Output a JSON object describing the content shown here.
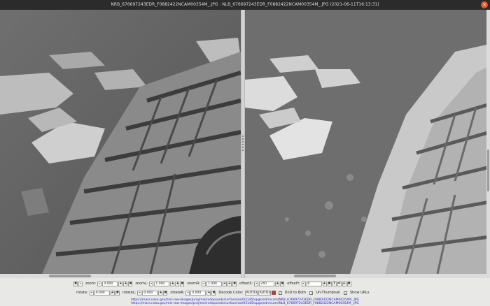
{
  "window": {
    "title": "NRB_676697243EDR_F0882422NCAM00354M_.JPG : NLB_676697243EDR_F0882422NCAM00354M_.JPG (2021-06-11T16:13:31)",
    "close_icon": "close-icon"
  },
  "images": {
    "left": {
      "alt": "NRB_676697243EDR_F0882422NCAM00354M_.JPG"
    },
    "right": {
      "alt": "NLB_676697243EDR_F0882422NCAM00354M_.JPG"
    }
  },
  "controls": {
    "zoom_label": "zoom:",
    "zoom_value": "4.000",
    "zoomL_label": "zoomL:",
    "zoomL_value": "1.000",
    "zoomR_label": "zoomR:",
    "zoomR_value": "1.000",
    "offsetX_label": "offsetX:",
    "offsetX_value": "240",
    "offsetY_label": "offsetY:",
    "offsetY_value": "0",
    "rotate_label": "rotate:",
    "rotate_value": "0.000",
    "rotateL_label": "rotateL:",
    "rotateL_value": "0.000",
    "rotateR_label": "rotateR:",
    "rotateR_value": "0.000",
    "decode_label": "Decode Color:",
    "decode_left": "AUTO3",
    "decode_right": "AUTO3",
    "dnd_label": "DnD to Both",
    "unthumb_label": "Un-Thumbnail",
    "showurls_label": "Show URLs",
    "btn_minus": "-",
    "btn_plus": "+",
    "btn_x": "✖",
    "btn_q": "?",
    "btn_eq": "="
  },
  "urls": {
    "right": "https://mars.nasa.gov/msl-raw-images/proj/msl/redops/ods/surface/sol/03145/opgs/edr/ncam/NRB_676697243EDR_F0882422NCAM00354M_.JPG",
    "left": "https://mars.nasa.gov/msl-raw-images/proj/msl/redops/ods/surface/sol/03145/opgs/edr/ncam/NLB_676697243EDR_F0882422NCAM00354M_.JPG"
  },
  "colors": {
    "titlebar": "#2b2b2b",
    "close": "#e95420",
    "link": "#2222cc"
  }
}
